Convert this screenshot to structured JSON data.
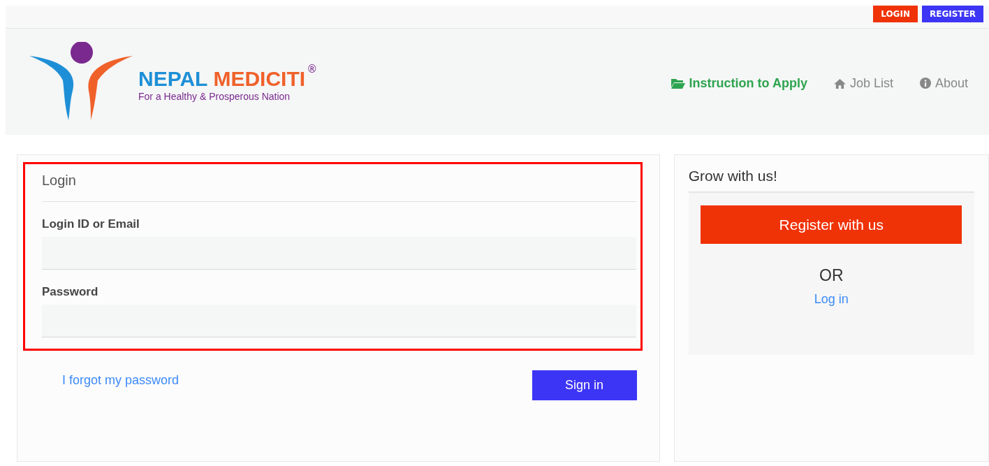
{
  "top_buttons": [
    {
      "label": "LOGIN",
      "kind": "login"
    },
    {
      "label": "REGISTER",
      "kind": "register"
    }
  ],
  "logo": {
    "word_1": "NEPAL",
    "word_2": "MEDICITI",
    "mark": "®",
    "tagline": "For a Healthy & Prosperous Nation"
  },
  "nav": [
    {
      "label": "Instruction to Apply",
      "kind": "folder",
      "selected": true
    },
    {
      "label": "Job List",
      "kind": "home",
      "selected": false
    },
    {
      "label": "About",
      "kind": "info",
      "selected": false
    }
  ],
  "login": {
    "title": "Login",
    "highlighted": true,
    "fields": [
      {
        "label": "Login ID or Email"
      },
      {
        "label": "Password"
      }
    ],
    "forgot": "I forgot my password",
    "submit": "Sign in"
  },
  "side": {
    "title": "Grow with us!",
    "register": "Register with us",
    "or": "OR",
    "login_link": "Log in"
  }
}
